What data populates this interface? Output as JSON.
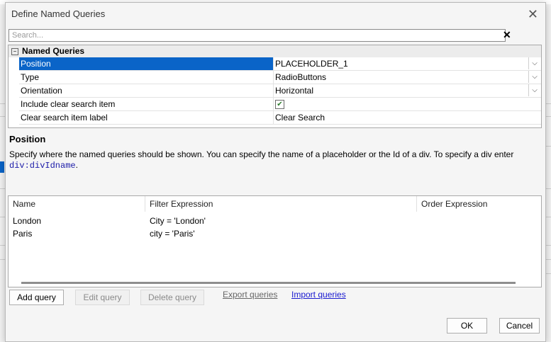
{
  "dialog": {
    "title": "Define Named Queries"
  },
  "search": {
    "placeholder": "Search..."
  },
  "props": {
    "group": "Named Queries",
    "rows": [
      {
        "name": "Position",
        "value": "PLACEHOLDER_1",
        "has_dropdown": true
      },
      {
        "name": "Type",
        "value": "RadioButtons",
        "has_dropdown": true
      },
      {
        "name": "Orientation",
        "value": "Horizontal",
        "has_dropdown": true
      },
      {
        "name": "Include clear search item",
        "checked": true
      },
      {
        "name": "Clear search item label",
        "value": "Clear Search"
      }
    ]
  },
  "help": {
    "title": "Position",
    "text": "Specify where the named queries should be shown. You can specify the name of a placeholder or the Id of a div. To specify a div enter ",
    "code": "div:divIdname",
    "end": "."
  },
  "grid": {
    "columns": [
      "Name",
      "Filter Expression",
      "Order Expression"
    ],
    "rows": [
      {
        "name": "London",
        "filter": "City = 'London'",
        "order": ""
      },
      {
        "name": "Paris",
        "filter": "city = 'Paris'",
        "order": ""
      }
    ]
  },
  "actions": {
    "add": "Add query",
    "edit": "Edit query",
    "delete": "Delete query",
    "export": "Export queries",
    "import": "Import queries"
  },
  "footer": {
    "ok": "OK",
    "cancel": "Cancel"
  }
}
